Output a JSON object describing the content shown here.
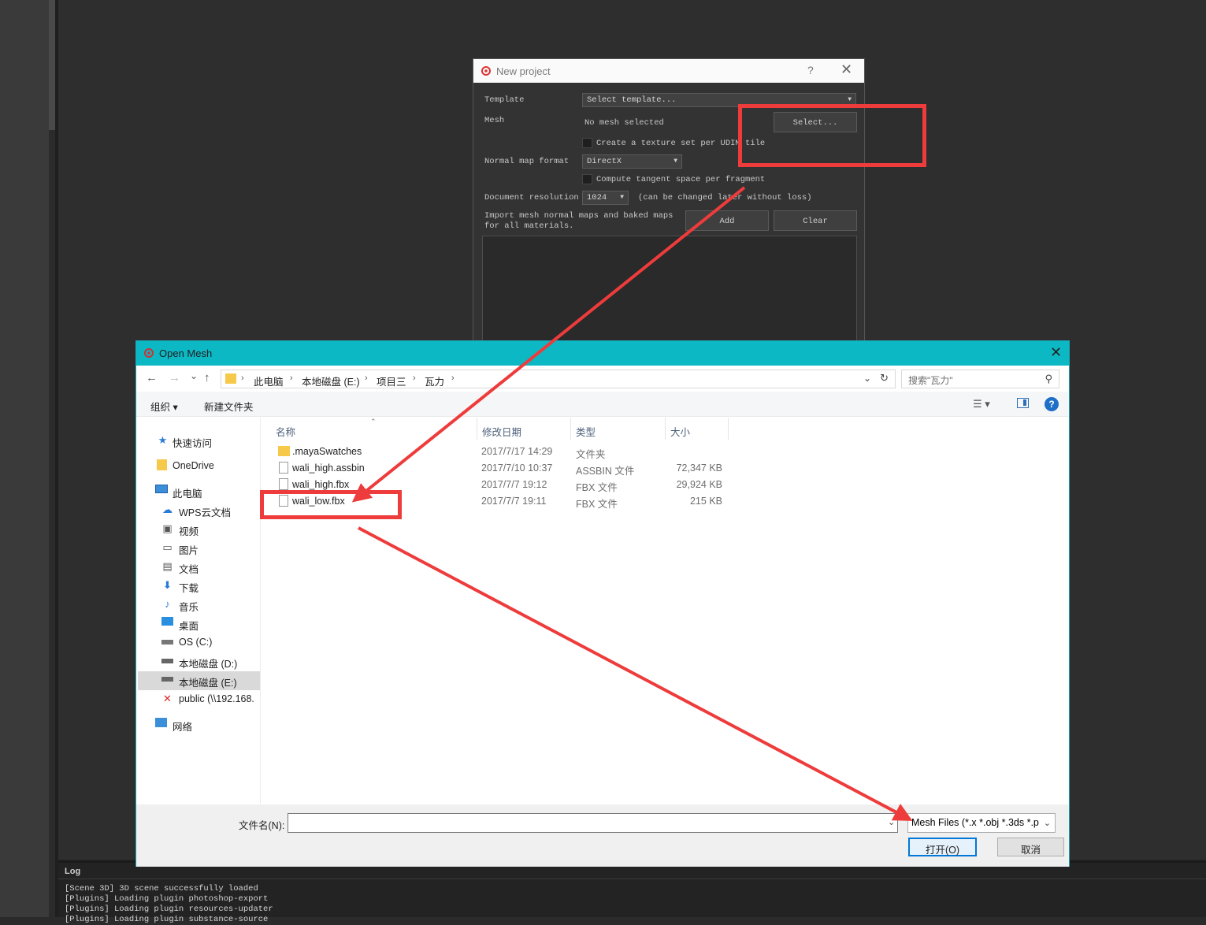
{
  "log": {
    "title": "Log",
    "lines": "[Scene 3D] 3D scene successfully loaded\n[Plugins] Loading plugin photoshop-export\n[Plugins] Loading plugin resources-updater\n[Plugins] Loading plugin substance-source"
  },
  "new_project": {
    "title": "New project",
    "help": "?",
    "close": "✕",
    "template_label": "Template",
    "template_value": "Select template...",
    "mesh_label": "Mesh",
    "mesh_value": "No mesh selected",
    "select_button": "Select...",
    "udim_label": "Create a texture set per UDIM tile",
    "normal_label": "Normal map format",
    "normal_value": "DirectX",
    "tangent_label": "Compute tangent space per fragment",
    "resolution_label": "Document resolution",
    "resolution_value": "1024",
    "resolution_note": "(can be changed later without loss)",
    "import_label": "Import mesh normal maps and baked maps\nfor all materials.",
    "add_button": "Add",
    "clear_button": "Clear"
  },
  "open_mesh": {
    "title": "Open Mesh",
    "close": "✕",
    "nav": {
      "back": "←",
      "forward": "→",
      "recent": "⌄",
      "up": "↑"
    },
    "breadcrumbs": [
      "此电脑",
      "本地磁盘 (E:)",
      "项目三",
      "瓦力"
    ],
    "search_placeholder": "搜索\"瓦力\"",
    "toolbar": {
      "organize": "组织 ▾",
      "new_folder": "新建文件夹"
    },
    "sidebar": [
      {
        "label": "快速访问",
        "icon": "star-icon"
      },
      {
        "label": "OneDrive",
        "icon": "folder-icon"
      },
      {
        "label": "此电脑",
        "icon": "computer-icon"
      },
      {
        "label": "WPS云文档",
        "icon": "cloud-icon"
      },
      {
        "label": "视频",
        "icon": "video-icon"
      },
      {
        "label": "图片",
        "icon": "picture-icon"
      },
      {
        "label": "文档",
        "icon": "document-icon"
      },
      {
        "label": "下载",
        "icon": "download-icon"
      },
      {
        "label": "音乐",
        "icon": "music-icon"
      },
      {
        "label": "桌面",
        "icon": "desktop-icon"
      },
      {
        "label": "OS (C:)",
        "icon": "drive-icon"
      },
      {
        "label": "本地磁盘 (D:)",
        "icon": "drive-icon"
      },
      {
        "label": "本地磁盘 (E:)",
        "icon": "drive-icon"
      },
      {
        "label": "public (\\\\192.168.",
        "icon": "network-drive-icon"
      },
      {
        "label": "网络",
        "icon": "network-icon"
      }
    ],
    "columns": {
      "name": "名称",
      "date": "修改日期",
      "type": "类型",
      "size": "大小"
    },
    "files": [
      {
        "name": ".mayaSwatches",
        "date": "2017/7/17 14:29",
        "type": "文件夹",
        "size": "",
        "kind": "folder"
      },
      {
        "name": "wali_high.assbin",
        "date": "2017/7/10 10:37",
        "type": "ASSBIN 文件",
        "size": "72,347 KB",
        "kind": "file"
      },
      {
        "name": "wali_high.fbx",
        "date": "2017/7/7 19:12",
        "type": "FBX 文件",
        "size": "29,924 KB",
        "kind": "file"
      },
      {
        "name": "wali_low.fbx",
        "date": "2017/7/7 19:11",
        "type": "FBX 文件",
        "size": "215 KB",
        "kind": "file"
      }
    ],
    "filename_label": "文件名(N):",
    "filename_value": "",
    "filter_value": "Mesh Files (*.x *.obj *.3ds *.p",
    "open_button": "打开(O)",
    "cancel_button": "取消"
  },
  "colors": {
    "annotation_red": "#ee3b3b",
    "dialog_accent": "#0db8c5"
  }
}
